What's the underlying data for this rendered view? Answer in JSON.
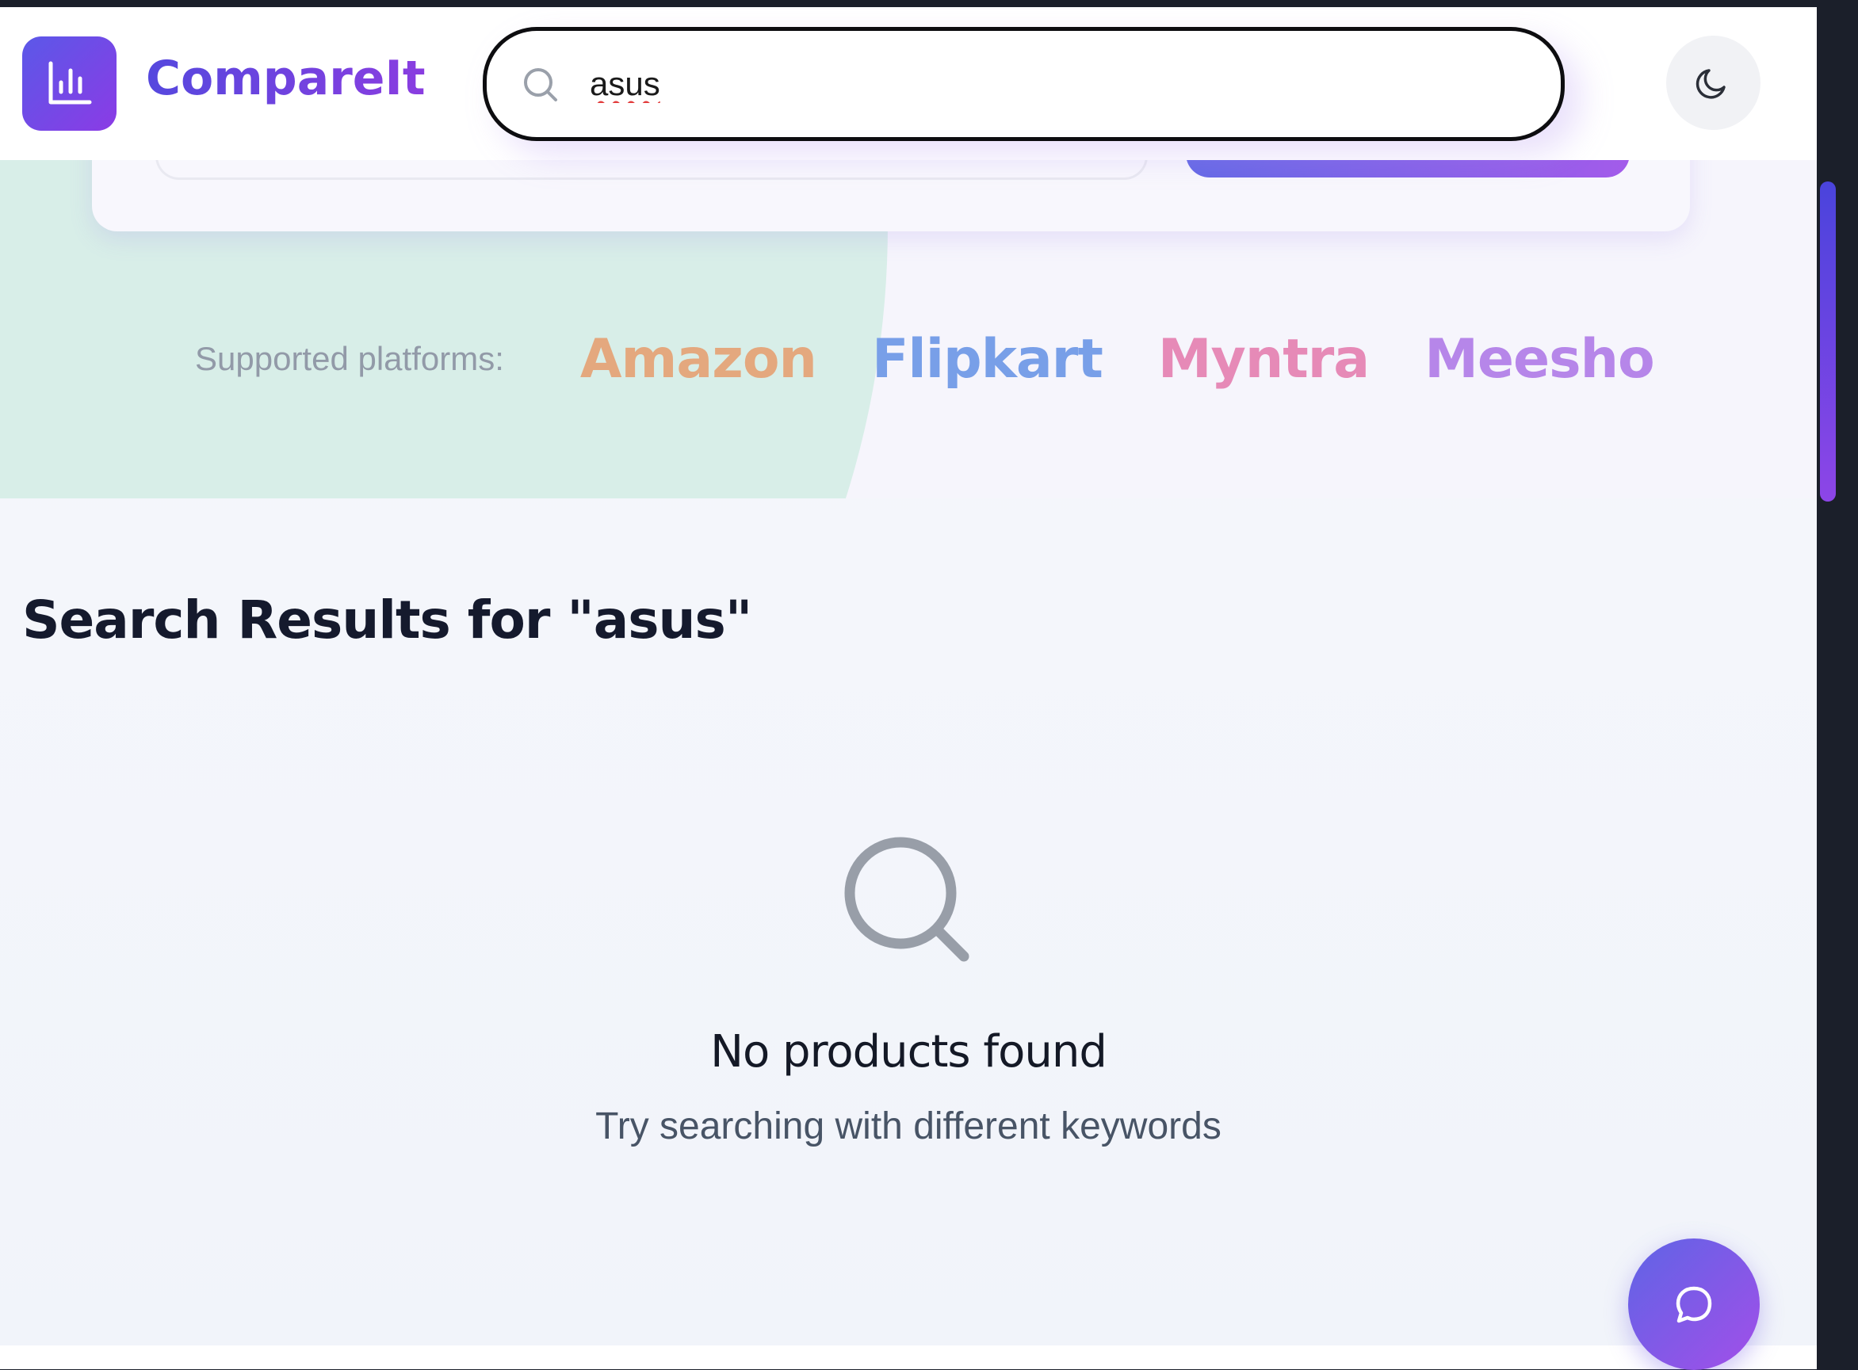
{
  "app": {
    "name": "CompareIt"
  },
  "header": {
    "search_value": "asus",
    "search_icon": "search-icon",
    "logo_icon": "bar-chart-icon",
    "theme_icon": "moon-icon"
  },
  "platforms": {
    "label": "Supported platforms:",
    "items": [
      {
        "name": "Amazon",
        "color": "#e4a87e"
      },
      {
        "name": "Flipkart",
        "color": "#789fe8"
      },
      {
        "name": "Myntra",
        "color": "#e68ab7"
      },
      {
        "name": "Meesho",
        "color": "#b686e9"
      }
    ]
  },
  "results": {
    "title": "Search Results for \"asus\"",
    "empty_title": "No products found",
    "empty_subtitle": "Try searching with different keywords",
    "empty_icon": "search-icon"
  },
  "chat": {
    "icon": "chat-icon"
  },
  "colors": {
    "accent_start": "#5f64e6",
    "accent_end": "#a24fe8",
    "blob": "#d8eee8"
  }
}
